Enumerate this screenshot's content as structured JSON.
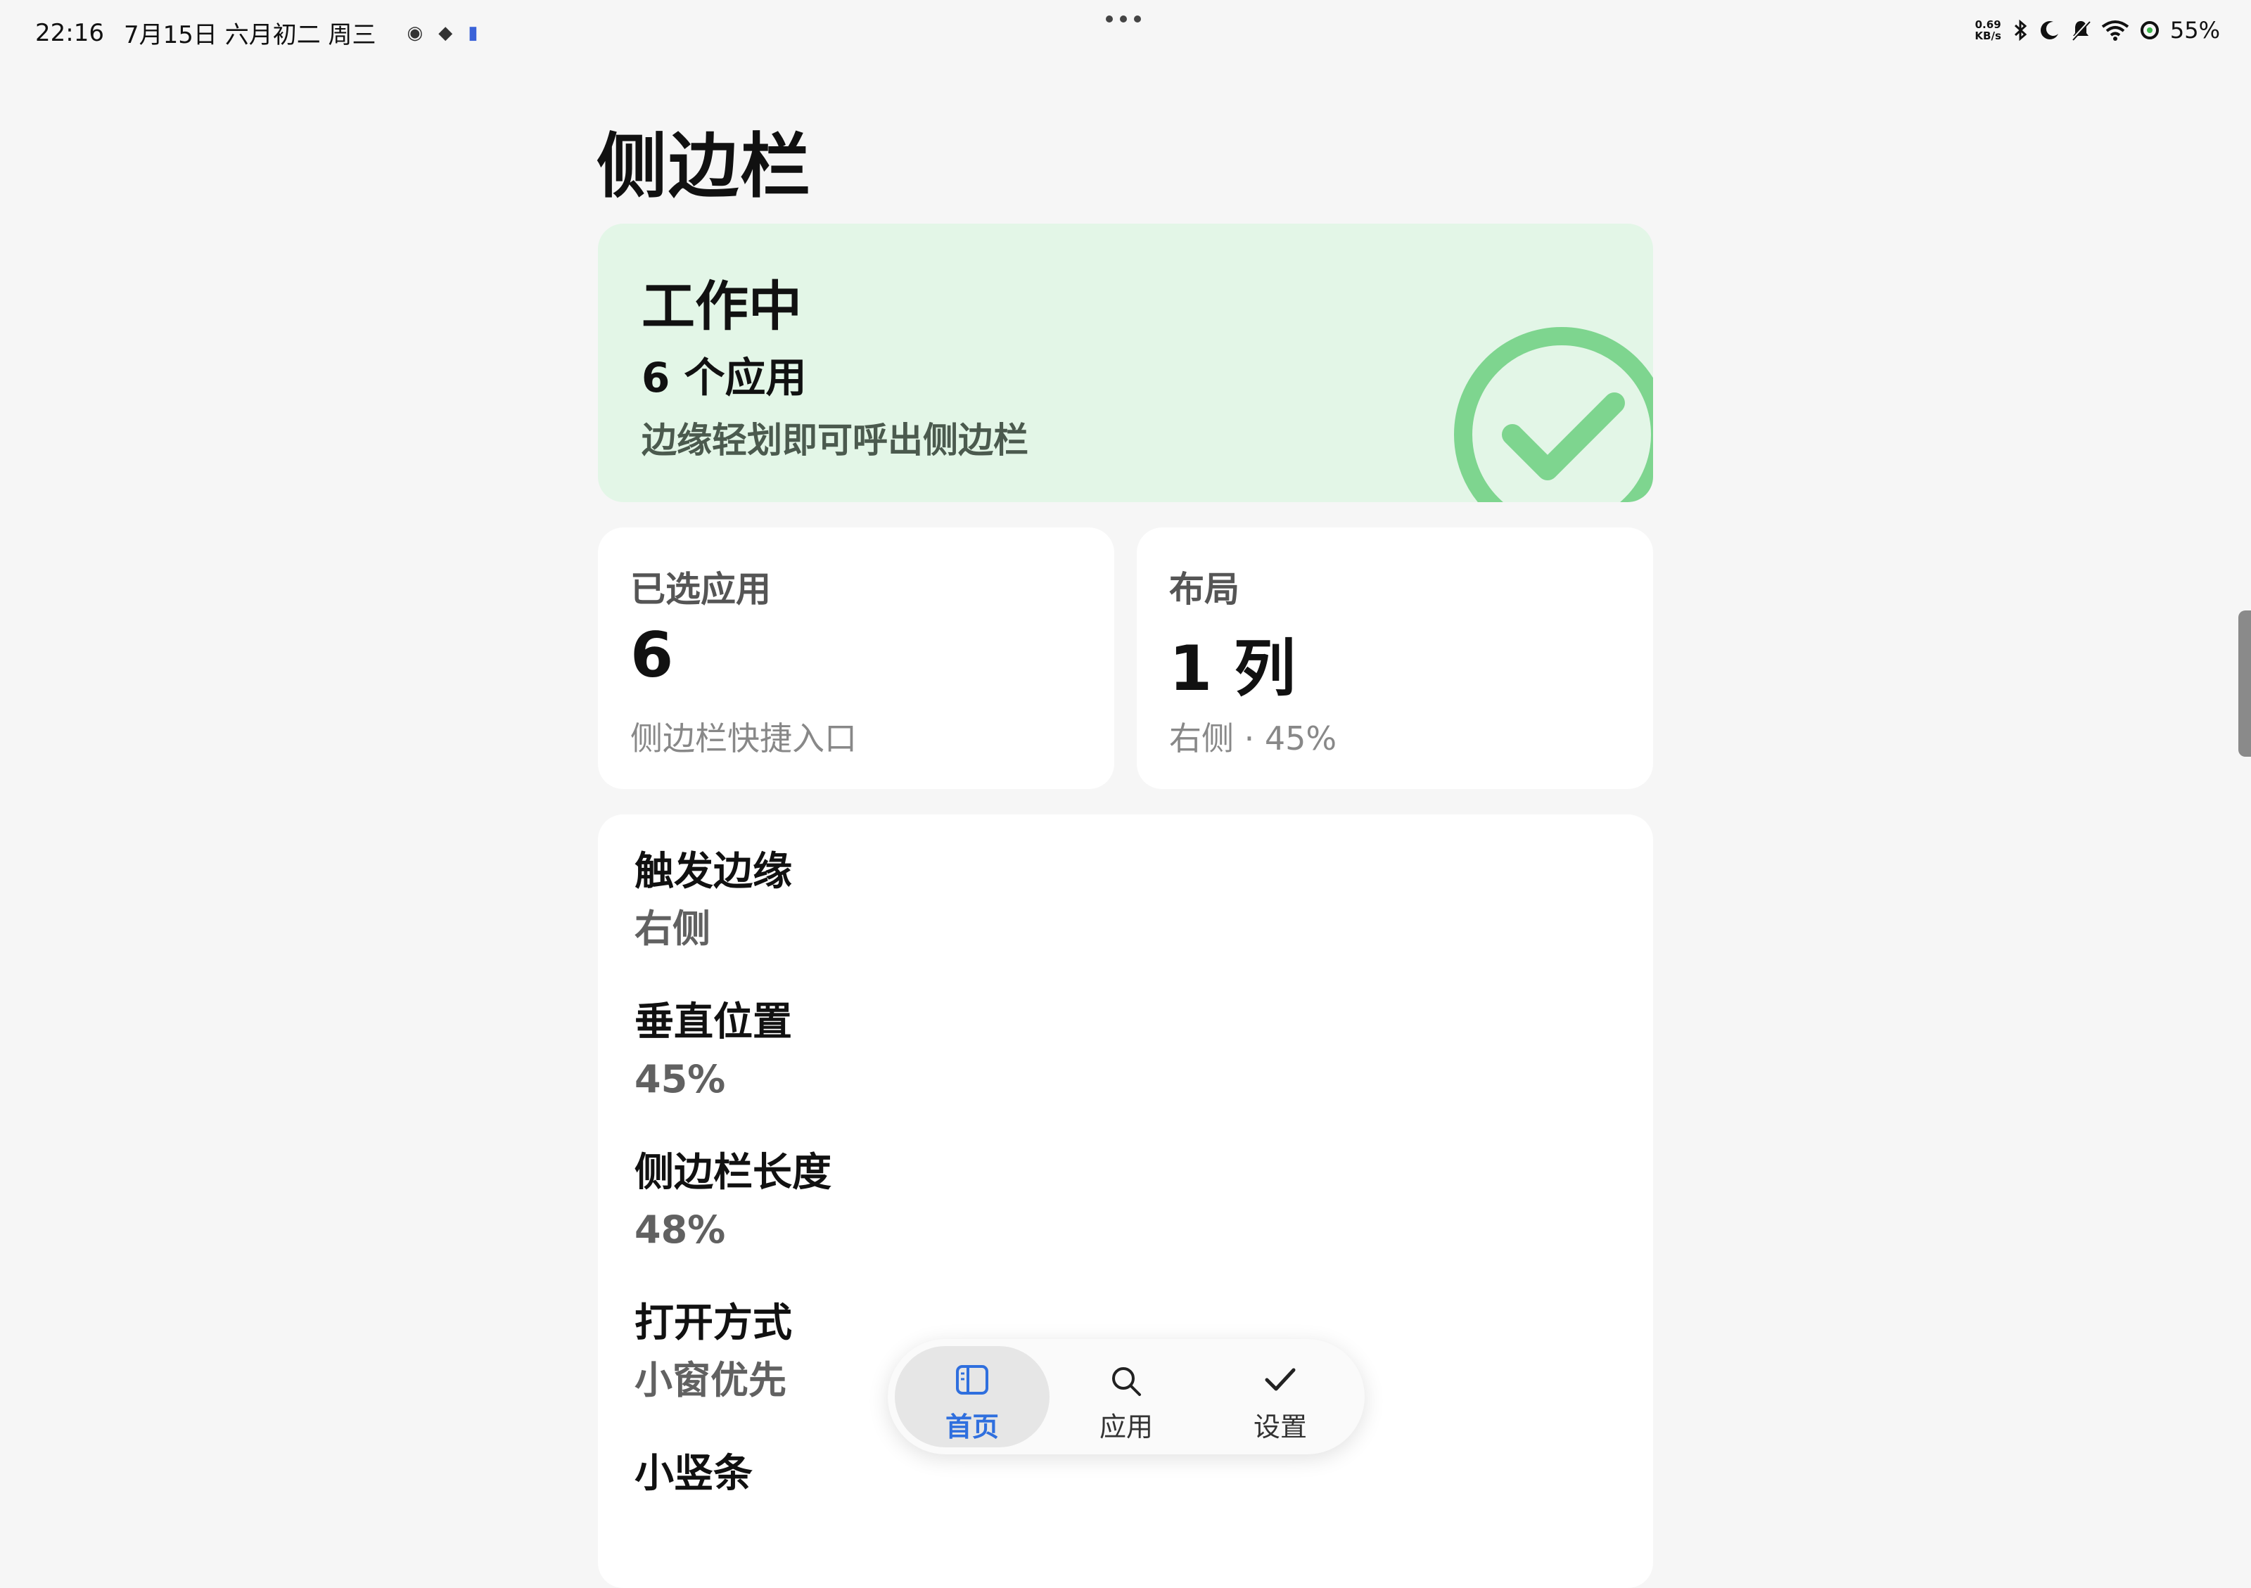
{
  "status_bar": {
    "time": "22:16",
    "date": "7月15日",
    "lunar": "六月初二",
    "weekday": "周三",
    "net_speed_value": "0.69",
    "net_speed_unit": "KB/s",
    "battery": "55%",
    "icons": [
      "eye-icon",
      "layers-icon",
      "app-icon",
      "bluetooth-icon",
      "moon-icon",
      "bell-off-icon",
      "wifi-icon",
      "ring-icon"
    ]
  },
  "page": {
    "title": "侧边栏"
  },
  "status_card": {
    "state": "工作中",
    "count": "6 个应用",
    "hint": "边缘轻划即可呼出侧边栏",
    "accent": "#7ed58f",
    "background": "#e3f6e7"
  },
  "stats": {
    "selected": {
      "label": "已选应用",
      "value": "6",
      "desc": "侧边栏快捷入口"
    },
    "layout": {
      "label": "布局",
      "value": "1 列",
      "desc": "右侧 · 45%"
    }
  },
  "settings": [
    {
      "key": "触发边缘",
      "value": "右侧"
    },
    {
      "key": "垂直位置",
      "value": "45%"
    },
    {
      "key": "侧边栏长度",
      "value": "48%"
    },
    {
      "key": "打开方式",
      "value": "小窗优先"
    },
    {
      "key": "小竖条",
      "value": ""
    }
  ],
  "nav": {
    "home": "首页",
    "apps": "应用",
    "settings": "设置",
    "active": "home",
    "active_color": "#2f6fde"
  }
}
